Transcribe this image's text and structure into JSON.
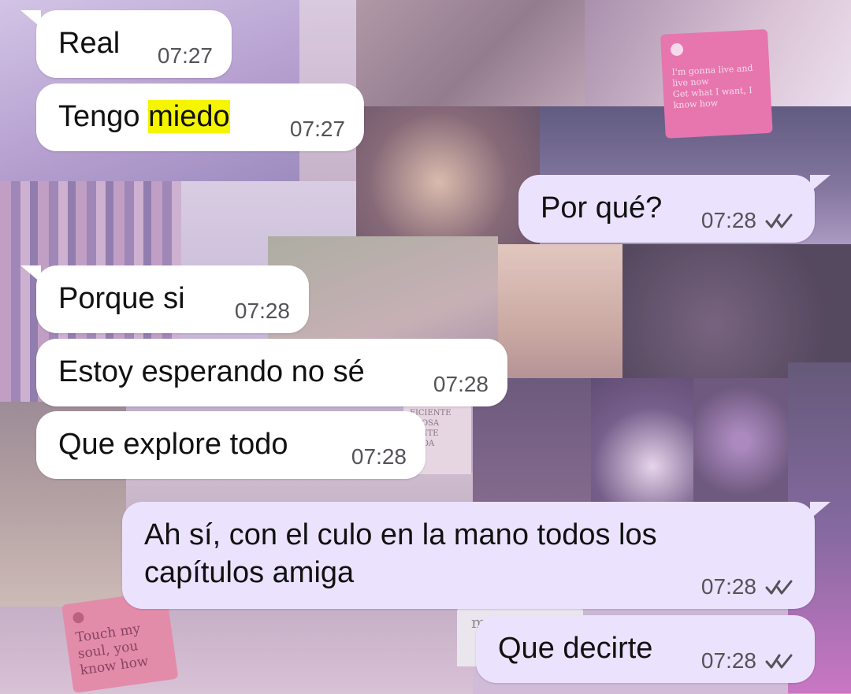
{
  "conversation": {
    "messages": [
      {
        "direction": "incoming",
        "parts": [
          {
            "text": "Real",
            "highlight": false
          }
        ],
        "time": "07:27"
      },
      {
        "direction": "incoming",
        "parts": [
          {
            "text": "Tengo ",
            "highlight": false
          },
          {
            "text": "miedo",
            "highlight": true
          }
        ],
        "time": "07:27"
      },
      {
        "direction": "outgoing",
        "parts": [
          {
            "text": "Por qué?",
            "highlight": false
          }
        ],
        "time": "07:28",
        "status_icon": "double-check-icon"
      },
      {
        "direction": "incoming",
        "parts": [
          {
            "text": "Porque si",
            "highlight": false
          }
        ],
        "time": "07:28"
      },
      {
        "direction": "incoming",
        "parts": [
          {
            "text": "Estoy esperando no sé",
            "highlight": false
          }
        ],
        "time": "07:28"
      },
      {
        "direction": "incoming",
        "parts": [
          {
            "text": "Que explore todo",
            "highlight": false
          }
        ],
        "time": "07:28"
      },
      {
        "direction": "outgoing",
        "parts": [
          {
            "text": "Ah sí, con el culo en la mano todos los capítulos amiga",
            "highlight": false
          }
        ],
        "time": "07:28",
        "status_icon": "double-check-icon"
      },
      {
        "direction": "outgoing",
        "parts": [
          {
            "text": "Que decirte",
            "highlight": false
          }
        ],
        "time": "07:28",
        "status_icon": "double-check-icon"
      }
    ]
  },
  "wallpaper": {
    "pink_note": {
      "lines": [
        "I'm gonna live and",
        "live now",
        "Get what I want, I",
        "know how"
      ]
    },
    "salmon_note": {
      "lines": [
        "Touch my",
        "soul, you",
        "know how"
      ]
    },
    "quote_card": {
      "lines": [
        "FICIENTE",
        "EROSA",
        "LANTE",
        "NADA"
      ]
    },
    "sign_text": "mejor"
  },
  "colors": {
    "incoming_bubble": "#ffffff",
    "outgoing_bubble": "#ebe3fd",
    "highlight": "#f5f500",
    "timestamp": "#555258",
    "ticks": "#555258"
  }
}
